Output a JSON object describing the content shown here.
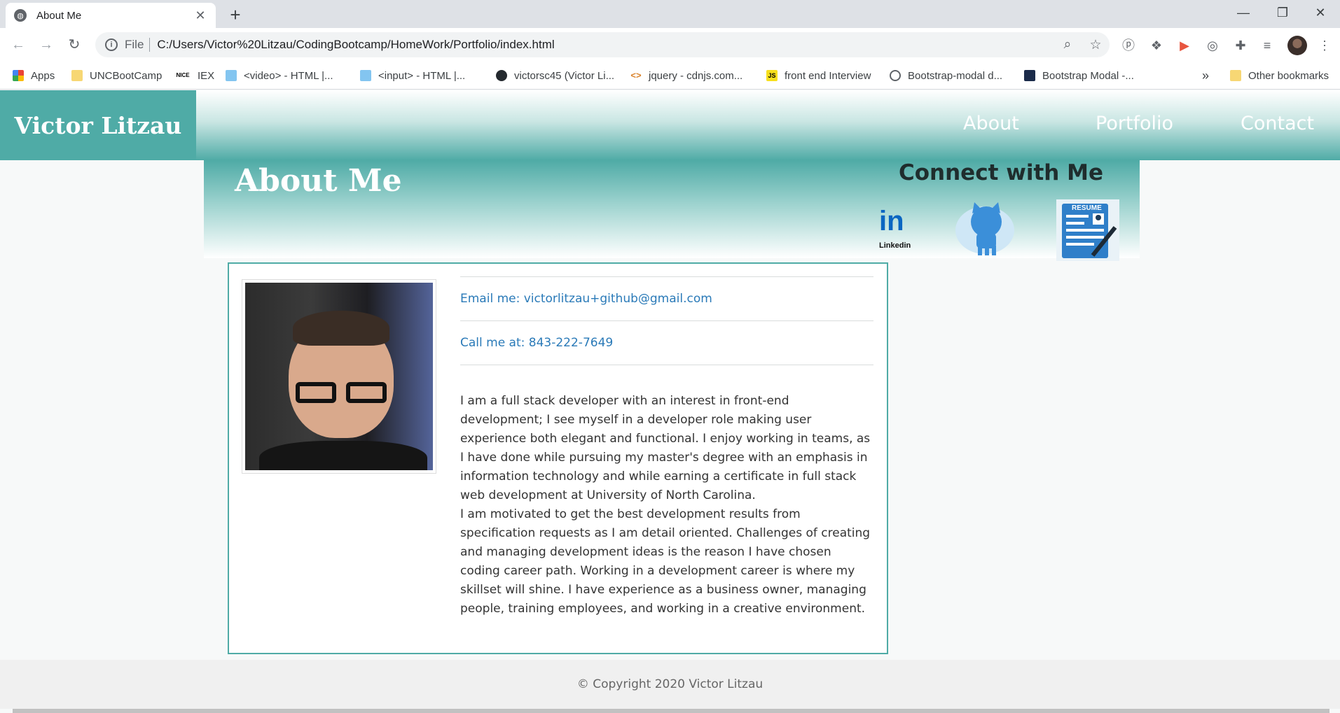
{
  "browser": {
    "tab_title": "About Me",
    "tab_close": "✕",
    "new_tab": "+",
    "window_controls": [
      "—",
      "❐",
      "✕"
    ],
    "url_scheme": "File",
    "url": "C:/Users/Victor%20Litzau/CodingBootcamp/HomeWork/Portfolio/index.html",
    "bookmarks": [
      {
        "label": "Apps",
        "icon": "apps-grid-icon"
      },
      {
        "label": "UNCBootCamp",
        "icon": "folder-icon"
      },
      {
        "label": "IEX",
        "icon": "nice-icon"
      },
      {
        "label": "<video> - HTML |...",
        "icon": "mdn-icon"
      },
      {
        "label": "<input> - HTML |...",
        "icon": "mdn-icon"
      },
      {
        "label": "victorsc45 (Victor Li...",
        "icon": "github-icon"
      },
      {
        "label": "jquery - cdnjs.com...",
        "icon": "cdnjs-icon"
      },
      {
        "label": "front end Interview",
        "icon": "js-icon"
      },
      {
        "label": "Bootstrap-modal d...",
        "icon": "globe-icon"
      },
      {
        "label": "Bootstrap Modal -...",
        "icon": "site-icon"
      }
    ],
    "bookmarks_more": "»",
    "other_bookmarks": "Other bookmarks"
  },
  "site": {
    "brand": "Victor Litzau",
    "nav": [
      "About",
      "Portfolio",
      "Contact"
    ],
    "page_title": "About Me",
    "connect_title": "Connect with Me",
    "social_icons": [
      "linkedin-icon",
      "github-octocat-icon",
      "resume-icon"
    ],
    "linkedin_text": "Linkedin",
    "resume_text": "RESUME",
    "email_link": "Email me: victorlitzau+github@gmail.com",
    "phone_link": "Call me at: 843-222-7649",
    "bio_paragraph_1": "I am a full stack developer with an interest in front-end development; I see myself in a developer role making user experience both elegant and functional. I enjoy working in teams, as I have done while pursuing my master's degree with an emphasis in information technology and while earning a certificate in full stack web development at University of North Carolina.",
    "bio_paragraph_2": "I am motivated to get the best development results from specification requests as I am detail oriented. Challenges of creating and managing development ideas is the reason I have chosen coding career path. Working in a development career is where my skillset will shine. I have experience as a business owner, managing people, training employees, and working in a creative environment.",
    "footer": "© Copyright 2020 Victor Litzau"
  },
  "colors": {
    "teal": "#4faba6",
    "link": "#2a7ab8"
  }
}
